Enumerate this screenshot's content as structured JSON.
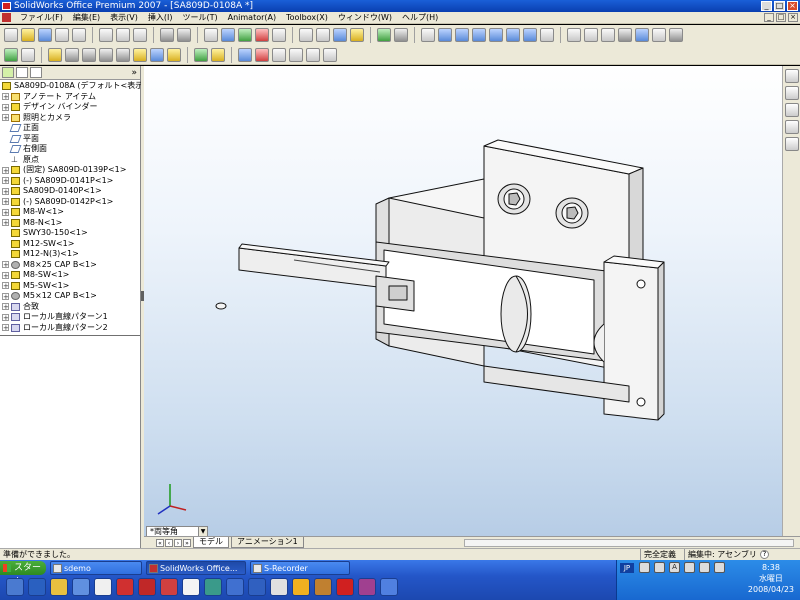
{
  "window": {
    "title": "SolidWorks Office Premium 2007 - [SA809D-0108A *]",
    "controls": {
      "minimize": "_",
      "maximize": "□",
      "close": "×"
    }
  },
  "menubar": {
    "items": [
      "ファイル(F)",
      "編集(E)",
      "表示(V)",
      "挿入(I)",
      "ツール(T)",
      "Animator(A)",
      "Toolbox(X)",
      "ウィンドウ(W)",
      "ヘルプ(H)"
    ]
  },
  "feature_tree": {
    "collapse_symbol": "»",
    "root": "SA809D-0108A (デフォルト<表示状態",
    "items": [
      {
        "label": "アノテート アイテム",
        "icon": "annotation-icon",
        "expand": "+"
      },
      {
        "label": "デザイン バインダー",
        "icon": "binder-icon",
        "expand": "+"
      },
      {
        "label": "照明とカメラ",
        "icon": "lights-icon",
        "expand": "+"
      },
      {
        "label": "正面",
        "icon": "plane-icon",
        "expand": ""
      },
      {
        "label": "平面",
        "icon": "plane-icon",
        "expand": ""
      },
      {
        "label": "右側面",
        "icon": "plane-icon",
        "expand": ""
      },
      {
        "label": "原点",
        "icon": "origin-icon",
        "expand": ""
      },
      {
        "label": "(固定) SA809D-0139P<1>",
        "icon": "part-icon",
        "expand": "+"
      },
      {
        "label": "(-) SA809D-0141P<1>",
        "icon": "part-icon",
        "expand": "+"
      },
      {
        "label": "SA809D-0140P<1>",
        "icon": "part-icon",
        "expand": "+"
      },
      {
        "label": "(-) SA809D-0142P<1>",
        "icon": "part-icon",
        "expand": "+"
      },
      {
        "label": "M8-W<1>",
        "icon": "part-icon",
        "expand": "+"
      },
      {
        "label": "M8-N<1>",
        "icon": "part-icon",
        "expand": "+"
      },
      {
        "label": "SWY30-150<1>",
        "icon": "part-icon",
        "expand": ""
      },
      {
        "label": "M12-SW<1>",
        "icon": "part-icon",
        "expand": ""
      },
      {
        "label": "M12-N(3)<1>",
        "icon": "part-icon",
        "expand": ""
      },
      {
        "label": "M8×25 CAP B<1>",
        "icon": "bolt-icon",
        "expand": "+"
      },
      {
        "label": "M8-SW<1>",
        "icon": "part-icon",
        "expand": "+"
      },
      {
        "label": "M5-SW<1>",
        "icon": "part-icon",
        "expand": "+"
      },
      {
        "label": "M5×12 CAP B<1>",
        "icon": "bolt-icon",
        "expand": "+"
      },
      {
        "label": "合致",
        "icon": "mates-icon",
        "expand": "+"
      },
      {
        "label": "ローカル直線パターン1",
        "icon": "pattern-icon",
        "expand": "+"
      },
      {
        "label": "ローカル直線パターン2",
        "icon": "pattern-icon",
        "expand": "+"
      }
    ]
  },
  "viewport": {
    "view_orientation": "*両等角",
    "tabs": [
      "モデル",
      "アニメーション1"
    ],
    "active_tab": "モデル"
  },
  "statusbar": {
    "message": "準備ができました。",
    "state": "完全定義",
    "mode": "編集中: アセンブリ",
    "help": "?"
  },
  "taskbar": {
    "start_label": "スタート",
    "buttons": [
      {
        "label": "sdemo",
        "active": false
      },
      {
        "label": "SolidWorks Office...",
        "active": true
      },
      {
        "label": "S-Recorder",
        "active": false
      }
    ],
    "language": "JP",
    "tray_ime": "A",
    "clock": {
      "time": "8:38",
      "weekday": "水曜日",
      "date": "2008/04/23"
    }
  },
  "colors": {
    "title_bar": "#1a5fd8",
    "viewport_top": "#ffffff",
    "viewport_bottom": "#b7cde6",
    "taskbar": "#2456c8",
    "start_button": "#3a9a2e"
  }
}
